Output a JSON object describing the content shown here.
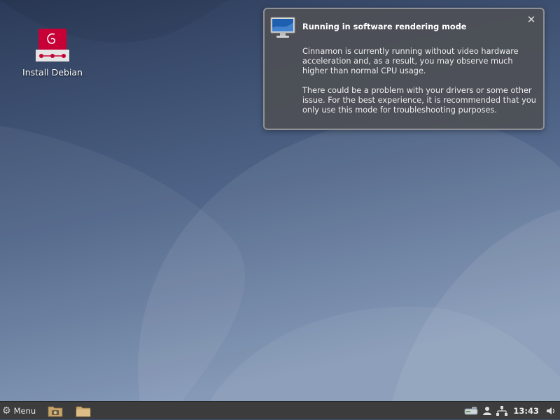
{
  "desktop": {
    "icons": [
      {
        "label": "Install Debian",
        "icon": "debian-installer-icon"
      }
    ]
  },
  "notification": {
    "icon": "monitor-icon",
    "title": "Running in software rendering mode",
    "paragraphs": [
      "Cinnamon is currently running without video hardware acceleration and, as a result, you may observe much higher than normal CPU usage.",
      "There could be a problem with your drivers or some other issue.  For the best experience, it is recommended that you only use this mode for troubleshooting purposes."
    ],
    "close_icon": "close-icon"
  },
  "panel": {
    "menu_label": "Menu",
    "launchers": [
      "file-manager-camera-icon",
      "folder-icon"
    ],
    "tray": [
      "removable-drive-icon",
      "user-icon",
      "network-icon"
    ],
    "clock": "13:43",
    "volume_icon": "volume-icon"
  },
  "colors": {
    "wallpaper_top": "#2e3d5c",
    "wallpaper_bottom": "#7f95b5",
    "panel": "#3c3c3c",
    "debian_red": "#c70036"
  }
}
